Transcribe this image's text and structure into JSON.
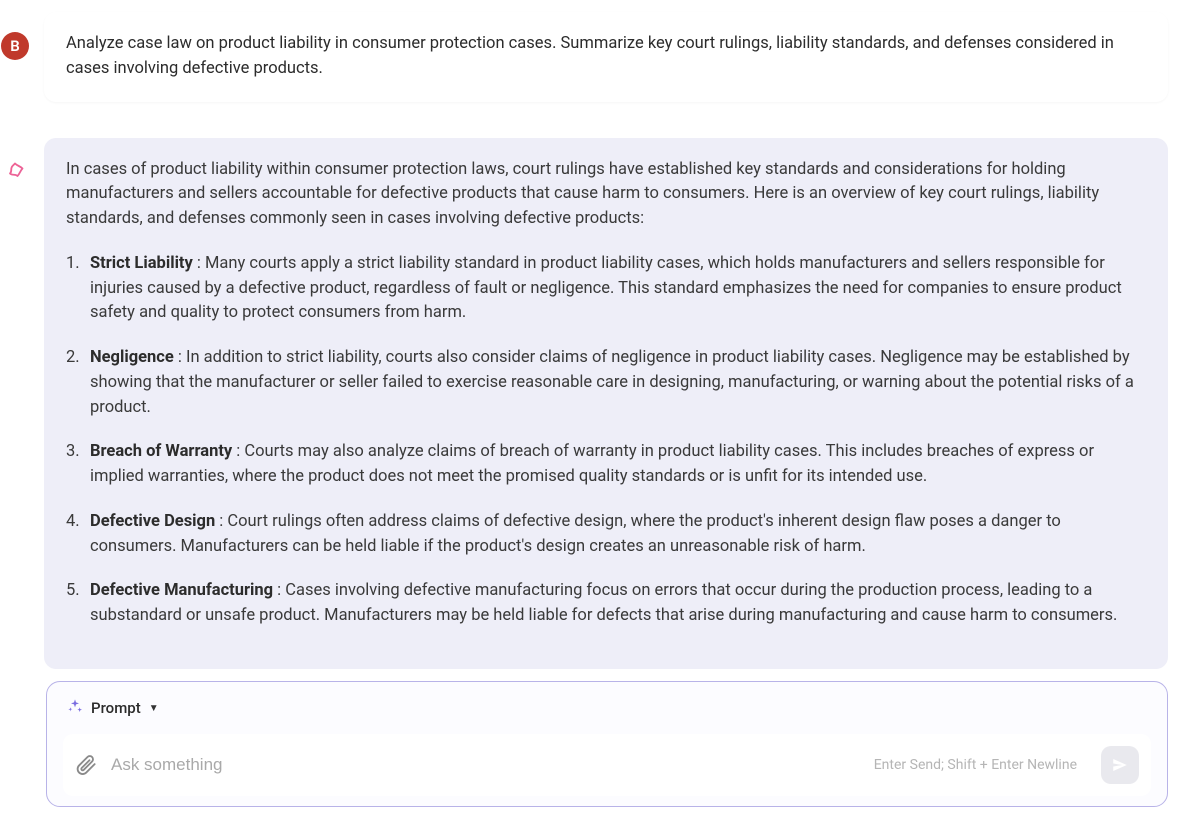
{
  "user": {
    "avatar_letter": "B",
    "message": "Analyze case law on product liability in consumer protection cases. Summarize key court rulings, liability standards, and defenses considered in cases involving defective products."
  },
  "ai": {
    "intro": "In cases of product liability within consumer protection laws, court rulings have established key standards and considerations for holding manufacturers and sellers accountable for defective products that cause harm to consumers. Here is an overview of key court rulings, liability standards, and defenses commonly seen in cases involving defective products:",
    "items": [
      {
        "title": "Strict Liability",
        "body": " : Many courts apply a strict liability standard in product liability cases, which holds manufacturers and sellers responsible for injuries caused by a defective product, regardless of fault or negligence. This standard emphasizes the need for companies to ensure product safety and quality to protect consumers from harm."
      },
      {
        "title": "Negligence",
        "body": " : In addition to strict liability, courts also consider claims of negligence in product liability cases. Negligence may be established by showing that the manufacturer or seller failed to exercise reasonable care in designing, manufacturing, or warning about the potential risks of a product."
      },
      {
        "title": "Breach of Warranty",
        "body": " : Courts may also analyze claims of breach of warranty in product liability cases. This includes breaches of express or implied warranties, where the product does not meet the promised quality standards or is unfit for its intended use."
      },
      {
        "title": "Defective Design",
        "body": " : Court rulings often address claims of defective design, where the product's inherent design flaw poses a danger to consumers. Manufacturers can be held liable if the product's design creates an unreasonable risk of harm."
      },
      {
        "title": "Defective Manufacturing",
        "body": " : Cases involving defective manufacturing focus on errors that occur during the production process, leading to a substandard or unsafe product. Manufacturers may be held liable for defects that arise during manufacturing and cause harm to consumers."
      }
    ]
  },
  "input": {
    "mode_label": "Prompt",
    "placeholder": "Ask something",
    "hint": "Enter Send; Shift + Enter Newline"
  }
}
